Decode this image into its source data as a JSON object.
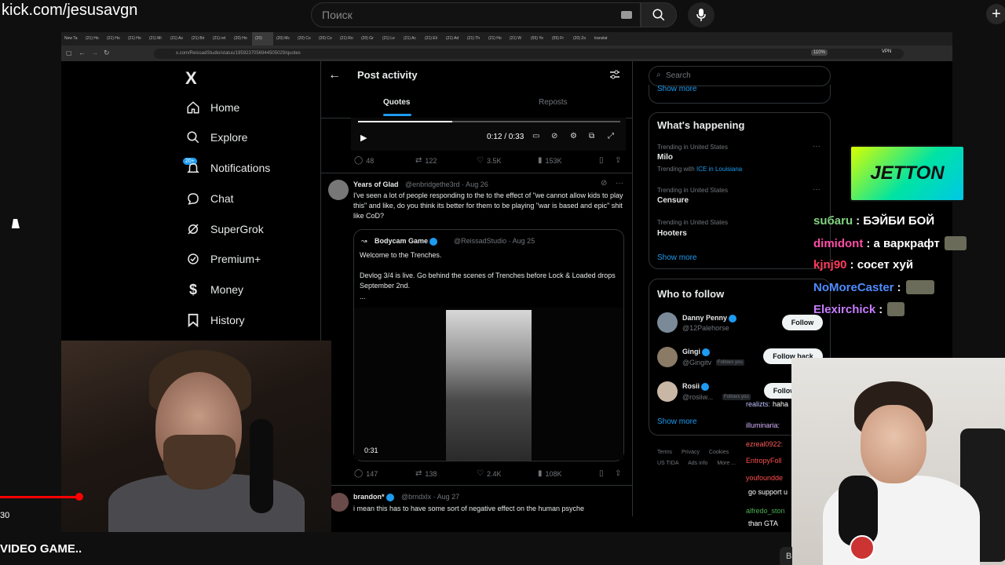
{
  "youtube": {
    "overlay_url": "kick.com/jesusavgn",
    "search_placeholder": "Поиск",
    "time": "30",
    "title": "VIDEO GAME..",
    "side_button": "В"
  },
  "browser": {
    "tabs": [
      "New Ta",
      "(21) Ho",
      "(21) Ho",
      "(21) Ho",
      "(21) Mi",
      "(21) As",
      "(21) Bri",
      "(21) ret",
      "(20) Ho",
      "(20)",
      "(20) Mc",
      "(20) Co",
      "(20) Co",
      "(21) Ro",
      "(20) Gr",
      "(21) Le",
      "(21) Ac",
      "(21) Eli",
      "(21) Ad",
      "(21) Th",
      "(21) Ho",
      "(21) W",
      "(55) Yo",
      "(55) Fr",
      "(20) Zo",
      "translat"
    ],
    "active_tab_index": 9,
    "address": "x.com/ReissadStudio/status/1959237056944505029/quotes",
    "zoom": "110%",
    "vpn": "VPN"
  },
  "nav": {
    "logo": "X",
    "badge": "20+",
    "items": [
      {
        "label": "Home",
        "icon": "home-icon"
      },
      {
        "label": "Explore",
        "icon": "search-icon"
      },
      {
        "label": "Notifications",
        "icon": "bell-icon"
      },
      {
        "label": "Chat",
        "icon": "chat-icon"
      },
      {
        "label": "SuperGrok",
        "icon": "grok-icon"
      },
      {
        "label": "Premium+",
        "icon": "x-premium-icon"
      },
      {
        "label": "Money",
        "icon": "money-icon"
      },
      {
        "label": "History",
        "icon": "bookmark-icon"
      }
    ]
  },
  "post_activity": {
    "title": "Post activity",
    "tabs": {
      "quotes": "Quotes",
      "reposts": "Reposts"
    },
    "video1": {
      "time": "0:12 / 0:33",
      "progress": 0.36
    },
    "post1_stats": {
      "replies": "48",
      "reposts": "122",
      "likes": "3.5K",
      "views": "153K"
    },
    "post2": {
      "name": "Years of Glad",
      "handle": "@enbridgethe3rd · Aug 26",
      "text": "I've seen a lot of people responding to the to the effect of \"we cannot allow kids to play this\" and like, do you think its better for them to be playing \"war is based and epic\" shit like CoD?",
      "quote": {
        "name": "Bodycam Game",
        "handle": "@ReissadStudio · Aug 25",
        "line1": "Welcome to the Trenches.",
        "line2": "Devlog 3/4 is live. Go behind the scenes of Trenches before Lock & Loaded drops September 2nd.",
        "ellipsis": "...",
        "video_time": "0:31"
      },
      "stats": {
        "replies": "147",
        "reposts": "138",
        "likes": "2.4K",
        "views": "108K"
      }
    },
    "post3": {
      "name": "brandon*",
      "handle": "@brndxlx · Aug 27",
      "text": "i mean this has to have some sort of negative effect on the human psyche"
    }
  },
  "right": {
    "search_placeholder": "Search",
    "show_more_top": "Show more",
    "whats_happening": {
      "title": "What's happening",
      "trends": [
        {
          "meta": "Trending in United States",
          "name": "Milo",
          "extra_prefix": "Trending with",
          "extra_link": "ICE in Louisiana"
        },
        {
          "meta": "Trending in United States",
          "name": "Censure"
        },
        {
          "meta": "Trending in United States",
          "name": "Hooters"
        }
      ],
      "show_more": "Show more"
    },
    "who_to_follow": {
      "title": "Who to follow",
      "people": [
        {
          "name": "Danny Penny",
          "handle": "@12Palehorse",
          "button": "Follow",
          "follows_you": ""
        },
        {
          "name": "Gingi",
          "handle": "@Gingitv",
          "button": "Follow back",
          "follows_you": "Follows you"
        },
        {
          "name": "Rosii",
          "handle": "@rosiiw...",
          "button": "Follow",
          "follows_you": "Follows you"
        }
      ],
      "show_more": "Show more"
    },
    "footer": [
      "Terms",
      "Privacy",
      "Cookies",
      "US TIDA",
      "Ads info",
      "More ..."
    ]
  },
  "stream": {
    "sponsor": "JETTON",
    "chat": [
      {
        "user": "suбaru",
        "msg": ": БЭЙБИ БОЙ",
        "color": "#7fd27f"
      },
      {
        "user": "dimidont",
        "msg": ": а варкрафт",
        "color": "#ff4da6"
      },
      {
        "user": "kjnj90",
        "msg": ": сосет хуй",
        "color": "#ff3b5c"
      },
      {
        "user": "NoMoreCaster",
        "msg": ":",
        "color": "#4f8bff"
      },
      {
        "user": "Elexirchick",
        "msg": ":",
        "color": "#c77dff"
      }
    ],
    "kick_chat": [
      {
        "user": "realizts:",
        "msg": "haha",
        "color": "#c0c0ff"
      },
      {
        "user": "illuminaria:",
        "msg": "",
        "color": "#d9b3ff"
      },
      {
        "user": "ezreal0922:",
        "msg": "",
        "color": "#ff5a5a"
      },
      {
        "user": "EntropyFoll",
        "msg": "",
        "color": "#ff4d4d"
      },
      {
        "user": "youfoundde",
        "msg": "",
        "color": "#ff4d4d"
      },
      {
        "user": "",
        "msg": "go support u",
        "color": "#ffffff"
      },
      {
        "user": "alfredo_ston",
        "msg": "",
        "color": "#4caf50"
      },
      {
        "user": "",
        "msg": "than GTA",
        "color": "#ffffff"
      }
    ]
  }
}
